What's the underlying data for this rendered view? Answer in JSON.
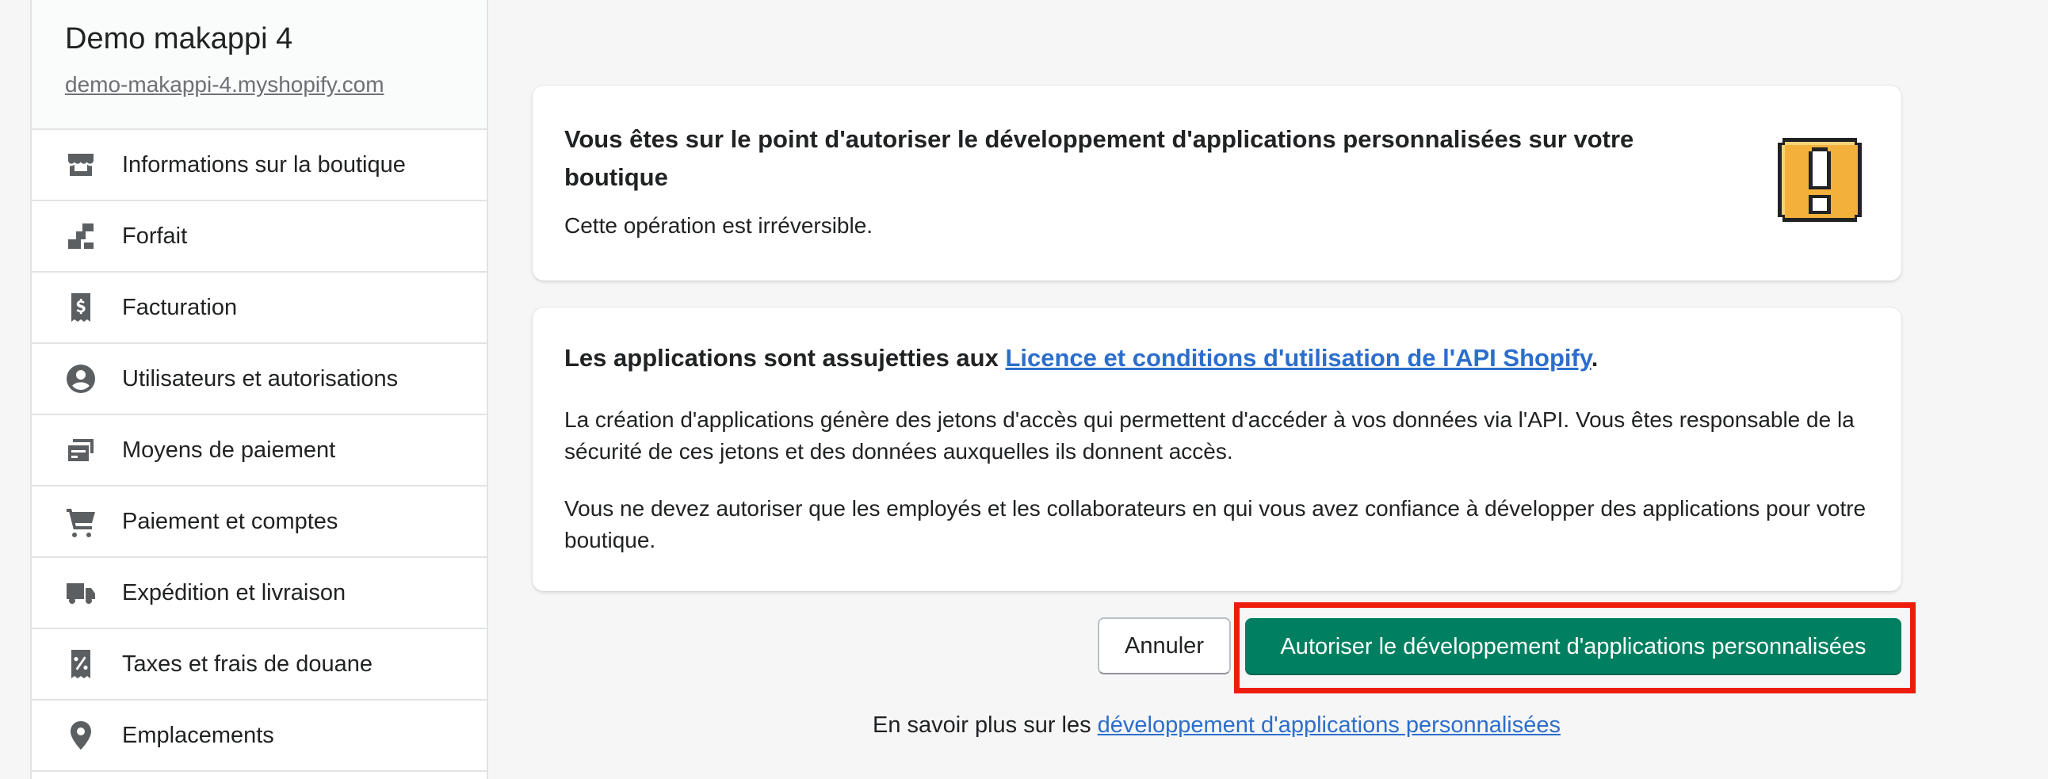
{
  "store": {
    "name": "Demo makappi 4",
    "domain": "demo-makappi-4.myshopify.com"
  },
  "sidebar": {
    "items": [
      {
        "label": "Informations sur la boutique",
        "icon": "store-icon"
      },
      {
        "label": "Forfait",
        "icon": "plan-icon"
      },
      {
        "label": "Facturation",
        "icon": "billing-icon"
      },
      {
        "label": "Utilisateurs et autorisations",
        "icon": "user-icon"
      },
      {
        "label": "Moyens de paiement",
        "icon": "payments-icon"
      },
      {
        "label": "Paiement et comptes",
        "icon": "cart-icon"
      },
      {
        "label": "Expédition et livraison",
        "icon": "truck-icon"
      },
      {
        "label": "Taxes et frais de douane",
        "icon": "tax-icon"
      },
      {
        "label": "Emplacements",
        "icon": "location-icon"
      }
    ]
  },
  "warning": {
    "title": "Vous êtes sur le point d'autoriser le développement d'applications personnalisées sur votre boutique",
    "subtitle": "Cette opération est irréversible.",
    "icon": "exclamation-icon",
    "icon_color": "#f3b13b"
  },
  "terms": {
    "title_prefix": "Les applications sont assujetties aux ",
    "title_link": "Licence et conditions d'utilisation de l'API Shopify",
    "title_suffix": ".",
    "paragraph1": "La création d'applications génère des jetons d'accès qui permettent d'accéder à vos données via l'API. Vous êtes responsable de la sécurité de ces jetons et des données auxquelles ils donnent accès.",
    "paragraph2": "Vous ne devez autoriser que les employés et les collaborateurs en qui vous avez confiance à développer des applications pour votre boutique."
  },
  "actions": {
    "cancel_label": "Annuler",
    "primary_label": "Autoriser le développement d'applications personnalisées",
    "primary_color": "#008060",
    "highlight_color": "#ee1c0b"
  },
  "footer": {
    "prefix": "En savoir plus sur les ",
    "link": "développement d'applications personnalisées"
  }
}
